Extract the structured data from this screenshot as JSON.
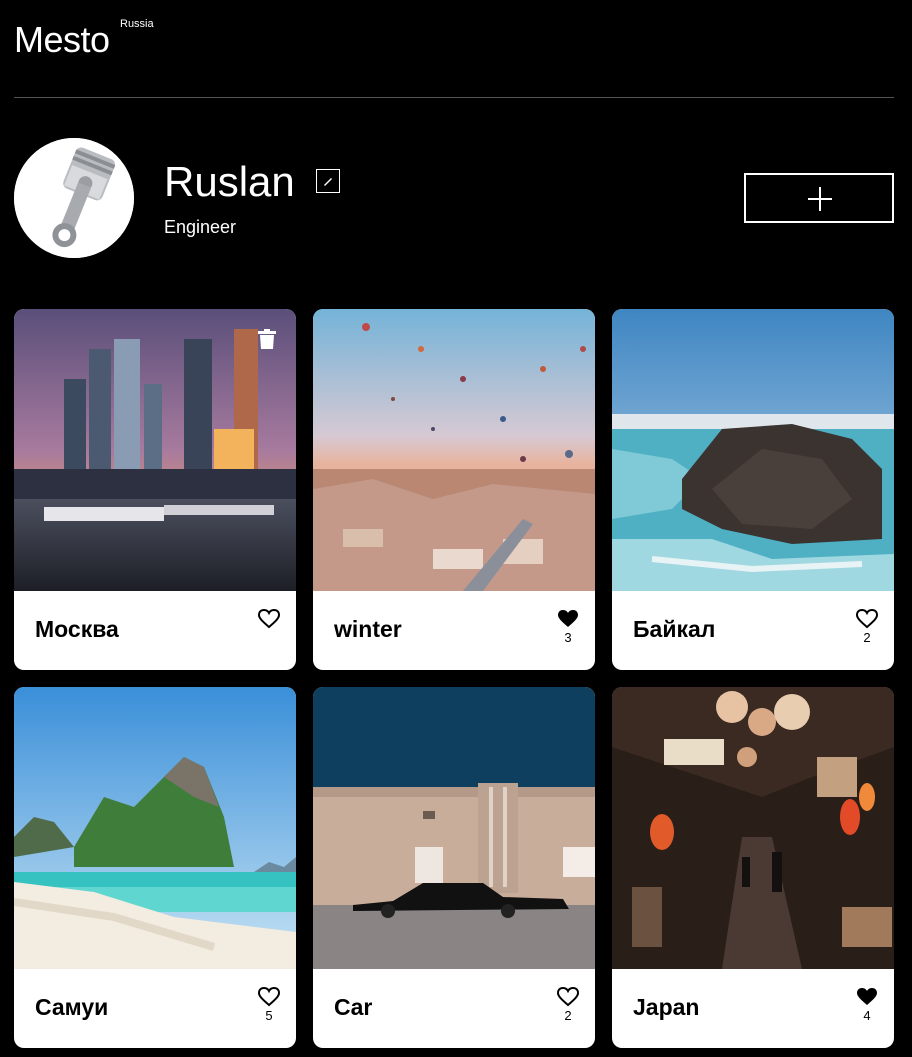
{
  "header": {
    "logo": "Mesto",
    "logo_sup": "Russia"
  },
  "profile": {
    "name": "Ruslan",
    "job": "Engineer"
  },
  "cards": [
    {
      "title": "Москва",
      "likes": "",
      "liked": false,
      "deletable": true
    },
    {
      "title": "winter",
      "likes": "3",
      "liked": true,
      "deletable": false
    },
    {
      "title": "Байкал",
      "likes": "2",
      "liked": false,
      "deletable": false
    },
    {
      "title": "Самуи",
      "likes": "5",
      "liked": false,
      "deletable": false
    },
    {
      "title": "Car",
      "likes": "2",
      "liked": false,
      "deletable": false
    },
    {
      "title": "Japan",
      "likes": "4",
      "liked": true,
      "deletable": false
    }
  ],
  "colors": {
    "background": "#000000",
    "card": "#ffffff",
    "divider": "#545454"
  }
}
